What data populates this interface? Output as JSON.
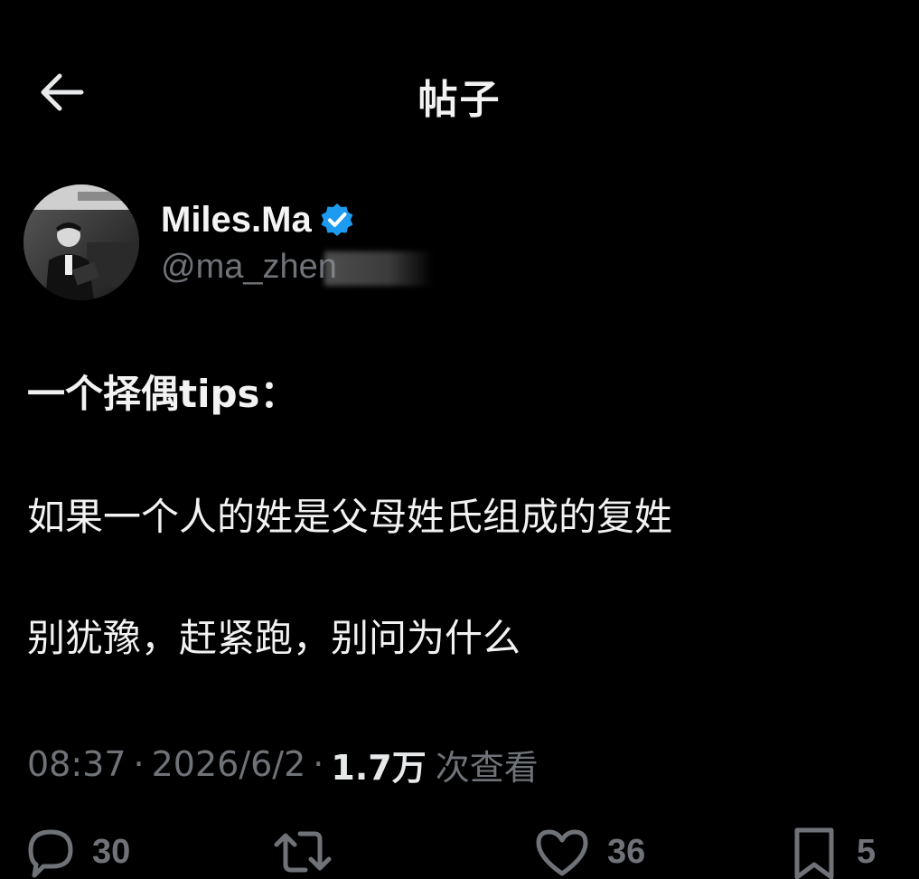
{
  "header": {
    "title": "帖子",
    "back_icon": "arrow-left-icon"
  },
  "author": {
    "display_name": "Miles.Ma",
    "handle": "@ma_zhen",
    "verified_icon": "verified-badge-icon",
    "verified_color": "#1d9bf0"
  },
  "post": {
    "lines": [
      "一个择偶tips：",
      "如果一个人的姓是父母姓氏组成的复姓",
      "别犹豫，赶紧跑，别问为什么"
    ]
  },
  "meta": {
    "time": "08:37",
    "separator": "·",
    "date": "2026/6/2",
    "views": "1.7万",
    "views_label": "次查看"
  },
  "actions": {
    "reply": {
      "icon": "reply-icon",
      "count": "30"
    },
    "repost": {
      "icon": "repost-icon",
      "count": ""
    },
    "like": {
      "icon": "heart-icon",
      "count": "36"
    },
    "bookmark": {
      "icon": "bookmark-icon",
      "count": "5"
    }
  },
  "colors": {
    "background": "#000000",
    "text_primary": "#e7e9ea",
    "text_secondary": "#6f7378"
  }
}
